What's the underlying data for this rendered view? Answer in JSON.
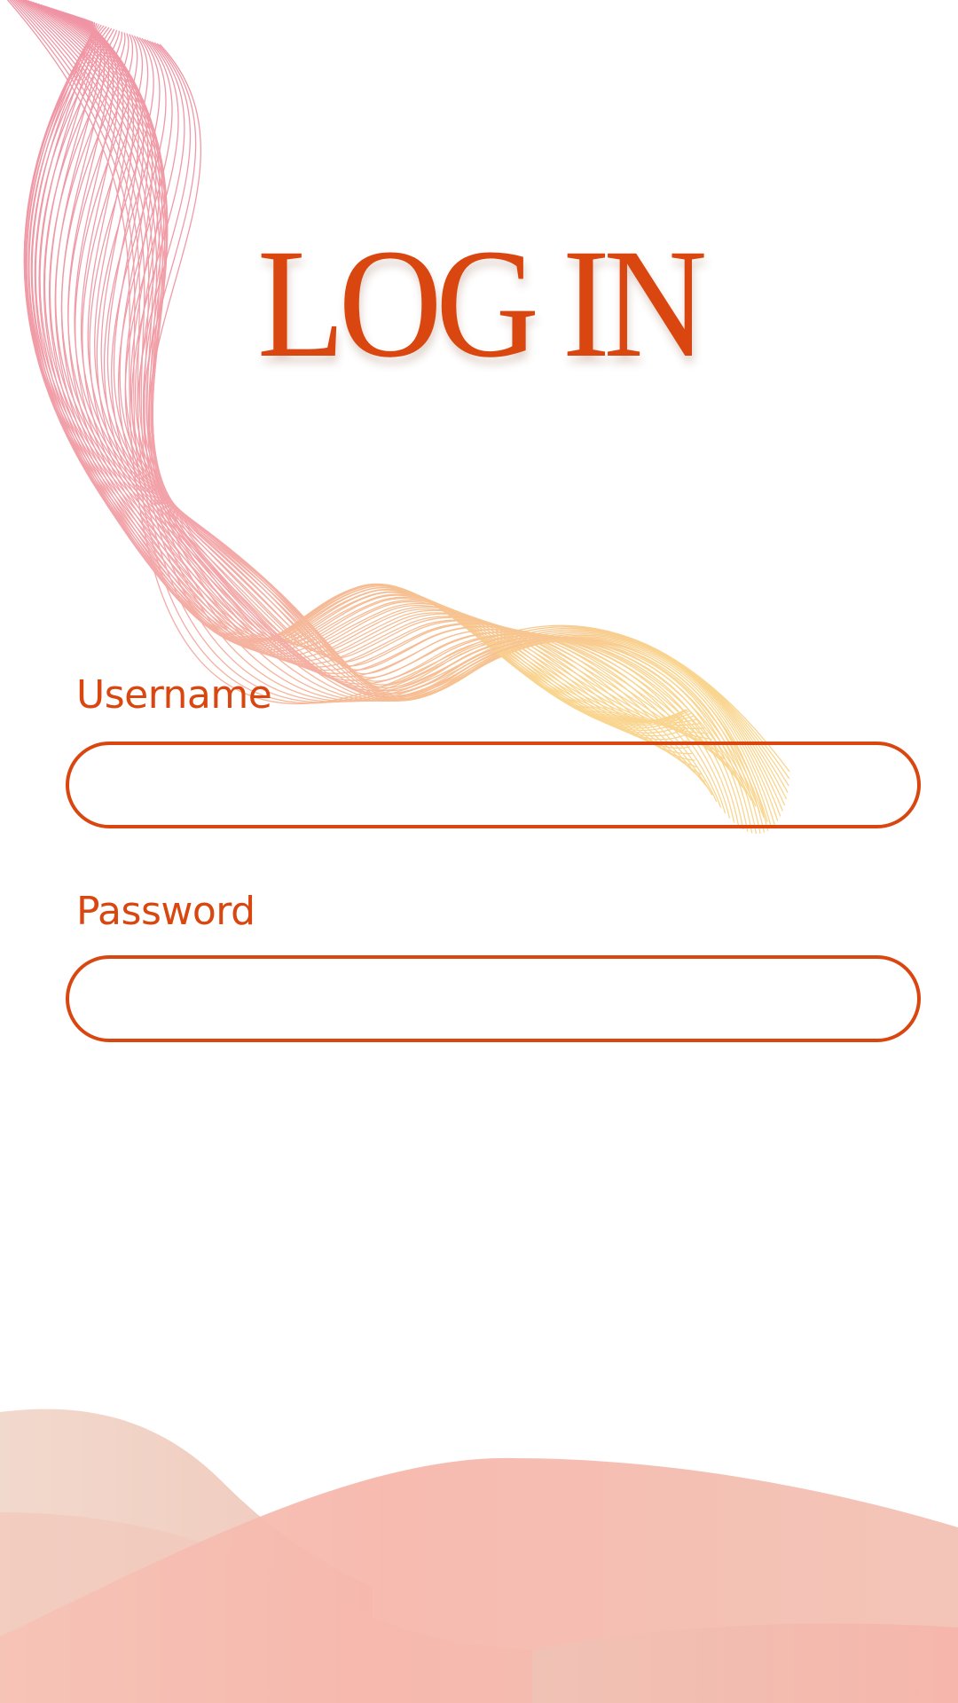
{
  "title": "LOG IN",
  "username": {
    "label": "Username",
    "value": "",
    "placeholder": ""
  },
  "password": {
    "label": "Password",
    "value": "",
    "placeholder": ""
  },
  "colors": {
    "accent": "#d9460f",
    "wave_pink": "#ee7e92",
    "wave_orange": "#f6b35e",
    "hill_light": "#f1dcd1",
    "hill_pink": "#f7b8ad",
    "background": "#ffffff"
  }
}
